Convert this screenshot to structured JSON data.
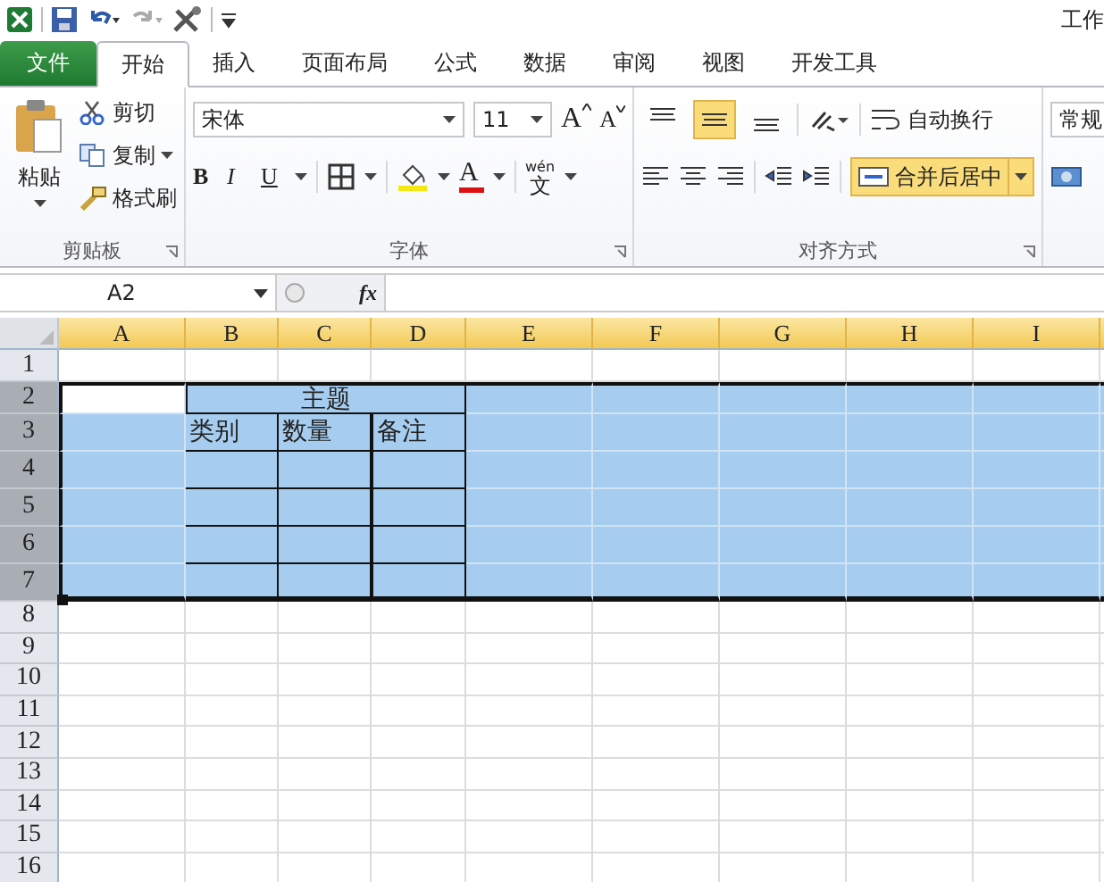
{
  "window": {
    "title": "工作"
  },
  "file_tab": "文件",
  "tabs": [
    {
      "label": "开始",
      "selected": true
    },
    {
      "label": "插入",
      "selected": false
    },
    {
      "label": "页面布局",
      "selected": false
    },
    {
      "label": "公式",
      "selected": false
    },
    {
      "label": "数据",
      "selected": false
    },
    {
      "label": "审阅",
      "selected": false
    },
    {
      "label": "视图",
      "selected": false
    },
    {
      "label": "开发工具",
      "selected": false
    }
  ],
  "clipboard": {
    "paste": "粘贴",
    "cut": "剪切",
    "copy": "复制",
    "painter": "格式刷",
    "group": "剪贴板"
  },
  "font": {
    "name": "宋体",
    "size": "11",
    "grow": "A",
    "shrink": "A",
    "bold": "B",
    "italic": "I",
    "underline": "U",
    "font_color": "A",
    "phonetic": "wén",
    "phonetic_char": "文",
    "group": "字体"
  },
  "alignment": {
    "vertical": [
      {
        "kind": "top",
        "selected": false
      },
      {
        "kind": "middle",
        "selected": true
      },
      {
        "kind": "bottom",
        "selected": false
      }
    ],
    "wrap": "自动换行",
    "merge": {
      "label": "合并后居中",
      "selected": true
    },
    "group": "对齐方式"
  },
  "number": {
    "format": "常规"
  },
  "name_box": "A2",
  "formula_label": "fx",
  "columns": [
    {
      "label": "A",
      "selected": true
    },
    {
      "label": "B",
      "selected": true
    },
    {
      "label": "C",
      "selected": true
    },
    {
      "label": "D",
      "selected": true
    },
    {
      "label": "E",
      "selected": true
    },
    {
      "label": "F",
      "selected": true
    },
    {
      "label": "G",
      "selected": true
    },
    {
      "label": "H",
      "selected": true
    },
    {
      "label": "I",
      "selected": true
    }
  ],
  "rows": [
    {
      "label": "1",
      "selected": false
    },
    {
      "label": "2",
      "selected": true
    },
    {
      "label": "3",
      "selected": true
    },
    {
      "label": "4",
      "selected": true
    },
    {
      "label": "5",
      "selected": true
    },
    {
      "label": "6",
      "selected": true
    },
    {
      "label": "7",
      "selected": true
    },
    {
      "label": "8",
      "selected": false
    },
    {
      "label": "9",
      "selected": false
    },
    {
      "label": "10",
      "selected": false
    },
    {
      "label": "11",
      "selected": false
    },
    {
      "label": "12",
      "selected": false
    },
    {
      "label": "13",
      "selected": false
    },
    {
      "label": "14",
      "selected": false
    },
    {
      "label": "15",
      "selected": false
    },
    {
      "label": "16",
      "selected": false
    }
  ],
  "table": {
    "title": "主题",
    "headers": [
      "类别",
      "数量",
      "备注"
    ]
  }
}
